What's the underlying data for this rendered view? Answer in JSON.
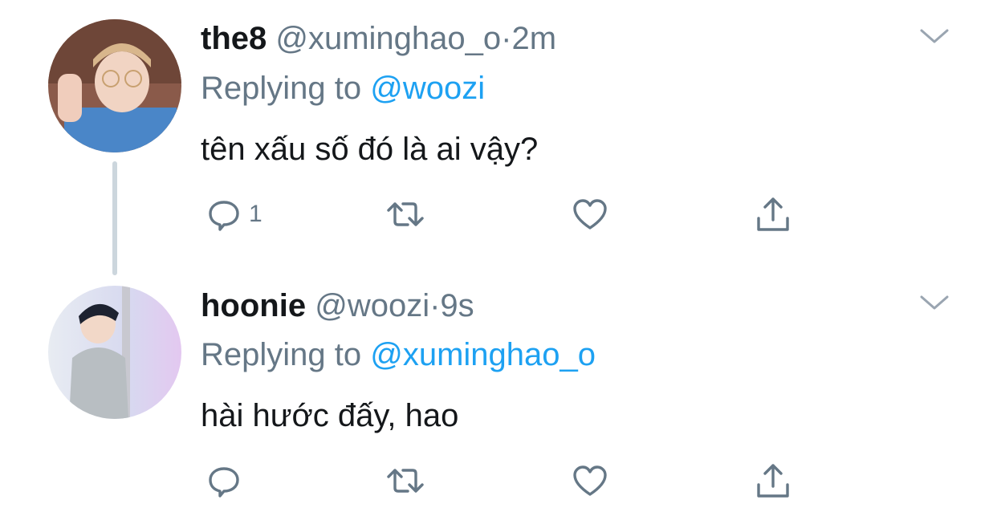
{
  "colors": {
    "name": "#14171a",
    "secondary": "#657786",
    "mention": "#1da1f2",
    "thread_line": "#ccd6dd",
    "icon": "#657786"
  },
  "tweets": [
    {
      "name": "the8",
      "handle": "@xuminghao_o",
      "dot": "·",
      "time": "2m",
      "replying_prefix": "Replying to ",
      "replying_to": "@woozi",
      "text": "tên xấu số đó là ai vậy?",
      "reply_count": "1",
      "avatar_icon": "avatar-photo-the8",
      "icons": [
        "reply-icon",
        "retweet-icon",
        "like-icon",
        "share-icon",
        "chevron-down-icon"
      ]
    },
    {
      "name": "hoonie",
      "handle": "@woozi",
      "dot": "·",
      "time": "9s",
      "replying_prefix": "Replying to ",
      "replying_to": "@xuminghao_o",
      "text": "hài hước đấy, hao",
      "reply_count": "",
      "avatar_icon": "avatar-photo-hoonie",
      "icons": [
        "reply-icon",
        "retweet-icon",
        "like-icon",
        "share-icon",
        "chevron-down-icon"
      ]
    }
  ]
}
